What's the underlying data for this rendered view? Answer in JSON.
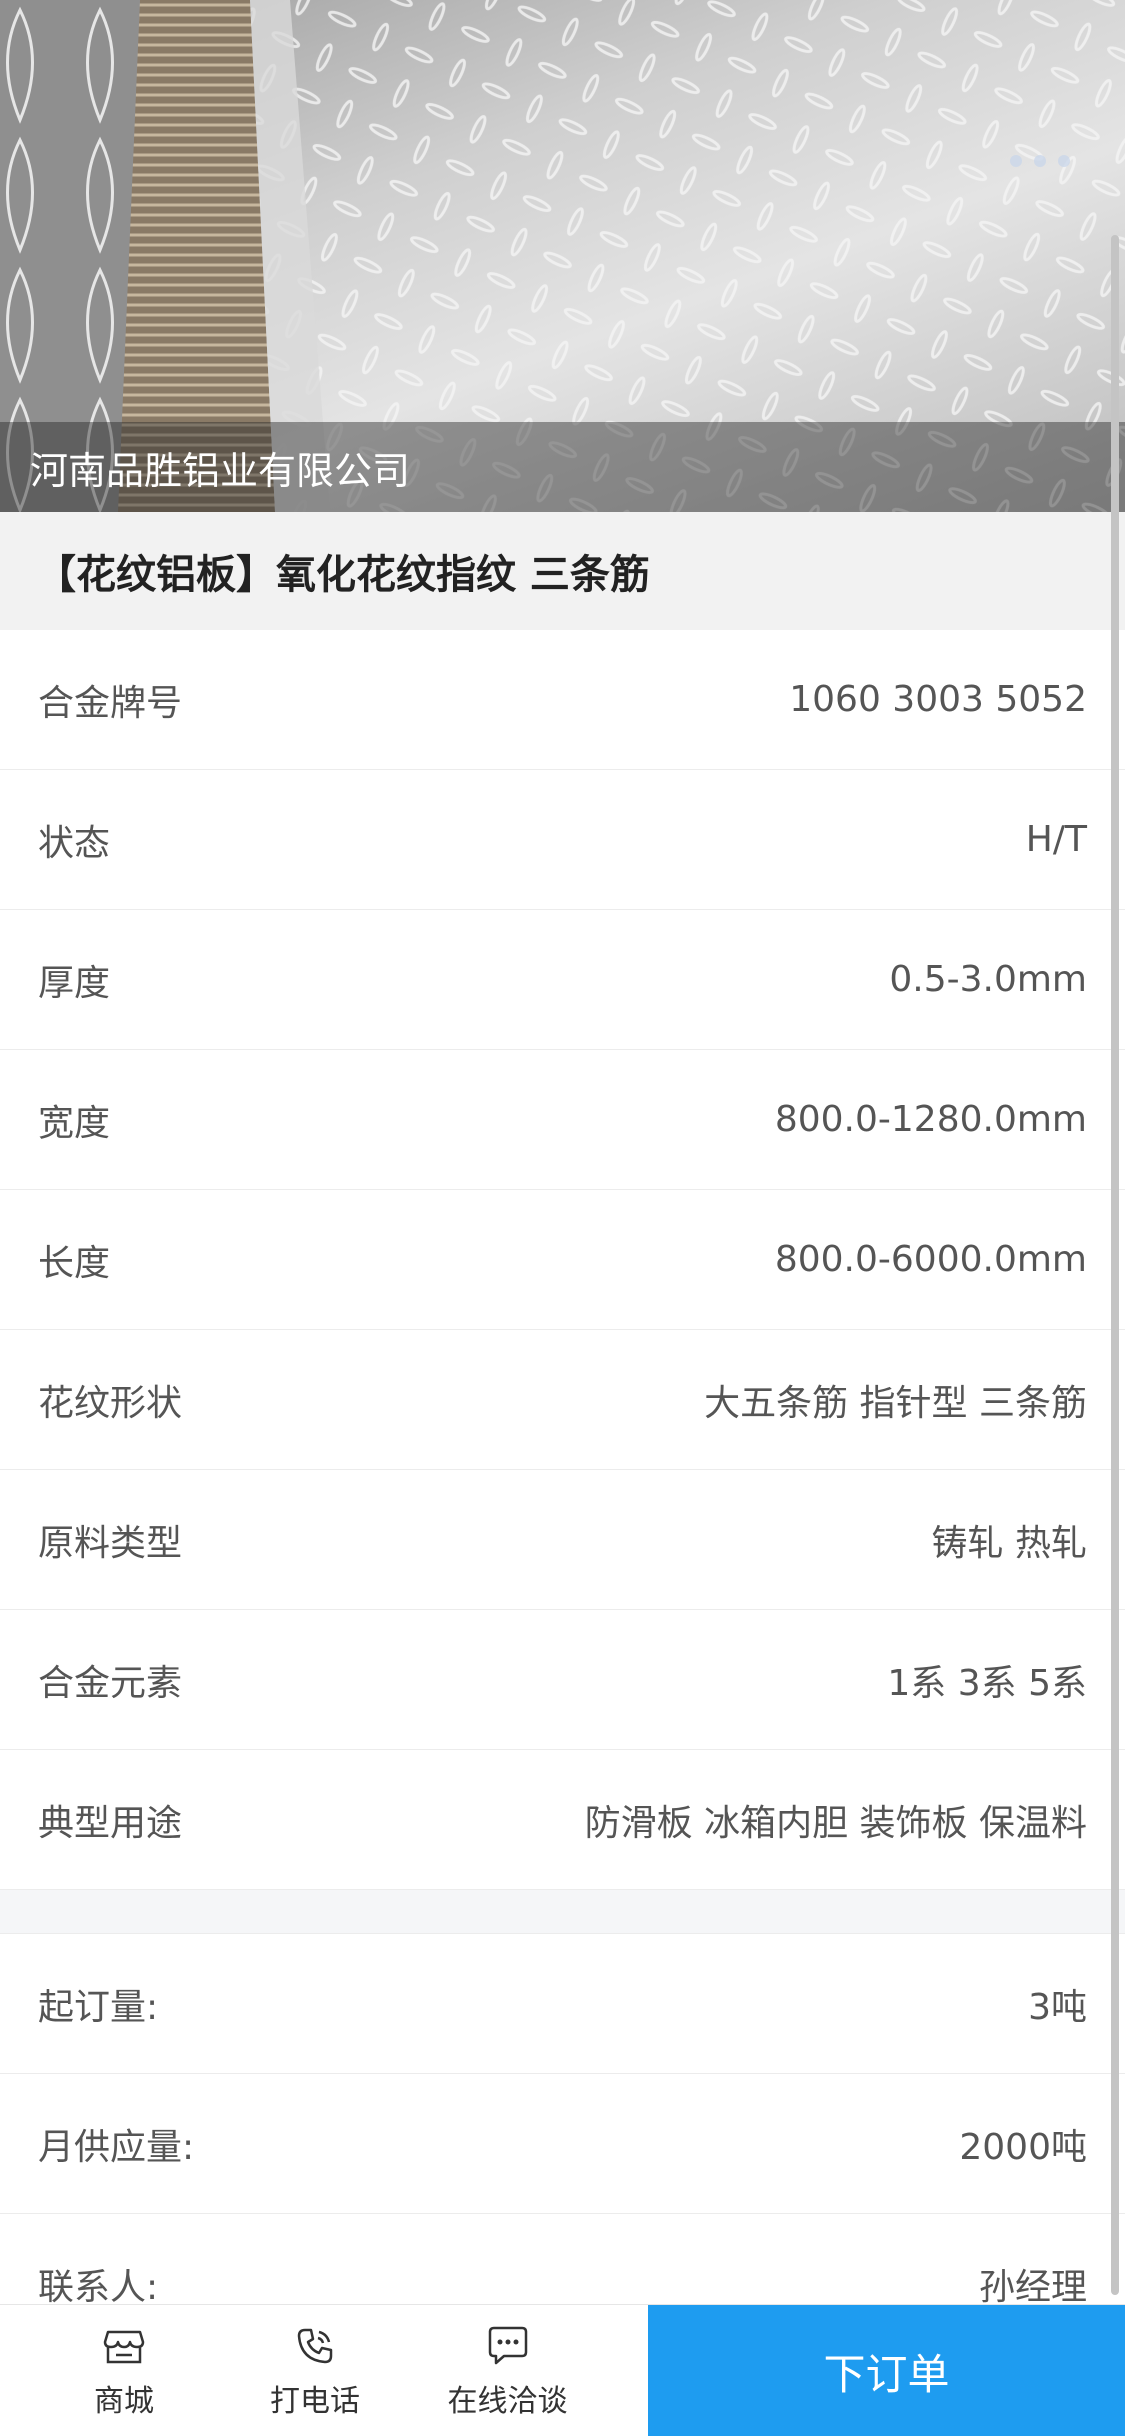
{
  "hero": {
    "company_name": "河南品胜铝业有限公司",
    "carousel_dots": 3
  },
  "product": {
    "title": "【花纹铝板】氧化花纹指纹 三条筋"
  },
  "specs": [
    {
      "label": "合金牌号",
      "value": "1060 3003 5052"
    },
    {
      "label": "状态",
      "value": "H/T"
    },
    {
      "label": "厚度",
      "value": "0.5-3.0mm"
    },
    {
      "label": "宽度",
      "value": "800.0-1280.0mm"
    },
    {
      "label": "长度",
      "value": "800.0-6000.0mm"
    },
    {
      "label": "花纹形状",
      "value": "大五条筋 指针型 三条筋"
    },
    {
      "label": "原料类型",
      "value": "铸轧 热轧"
    },
    {
      "label": "合金元素",
      "value": "1系 3系 5系"
    },
    {
      "label": "典型用途",
      "value": "防滑板 冰箱内胆 装饰板 保温料"
    }
  ],
  "supply": [
    {
      "label": "起订量:",
      "value": "3吨"
    },
    {
      "label": "月供应量:",
      "value": "2000吨"
    },
    {
      "label": "联系人:",
      "value": "孙经理"
    }
  ],
  "tabbar": {
    "shop": {
      "label": "商城",
      "icon": "shop-icon"
    },
    "call": {
      "label": "打电话",
      "icon": "phone-icon"
    },
    "chat": {
      "label": "在线洽谈",
      "icon": "chat-icon"
    },
    "order_label": "下订单"
  },
  "colors": {
    "accent": "#1e9cf0",
    "title_bg": "#f2f2f2"
  }
}
